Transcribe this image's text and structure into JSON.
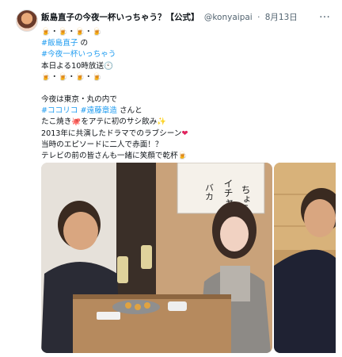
{
  "tweet": {
    "display_name": "飯島直子の今夜一杯いっちゃう？【公式】",
    "handle": "@konyaipai",
    "separator": "·",
    "date": "8月13日",
    "more_label": "…",
    "beer_row_1": "🍺・🍺・🍺・🍺",
    "mention": "#飯島直子",
    "mention_suffix": " の",
    "hashtag_show": "#今夜一杯いっちゃう",
    "airtime": "本日よる10時放送",
    "clock": "🕙",
    "beer_row_2": "🍺・🍺・🍺・🍺",
    "tonight_line": "今夜は東京・丸の内で",
    "hashtag_cocorico": "#ココリコ",
    "hashtag_endo": "#遠藤章造",
    "san_to": " さんと",
    "tako_pre": "たこ焼き",
    "octopus": "🐙",
    "tako_post": "をアテに初のサシ飲み",
    "sparkle": "✨",
    "drama_line": "2013年に共演したドラマでのラブシーン",
    "heart": "❤",
    "episode_line": "当時のエピソードに二人で赤面！？",
    "tv_line": "テレビの前の皆さんも一緒に笑顔で乾杯",
    "beer_end": "🍺"
  },
  "photo_main": {
    "calligraphy_1": "ちょうど",
    "calligraphy_2": "イチャ",
    "calligraphy_3": "バカ"
  },
  "colors": {
    "link": "#1d9bf0",
    "text": "#0f1419",
    "muted": "#536471"
  }
}
